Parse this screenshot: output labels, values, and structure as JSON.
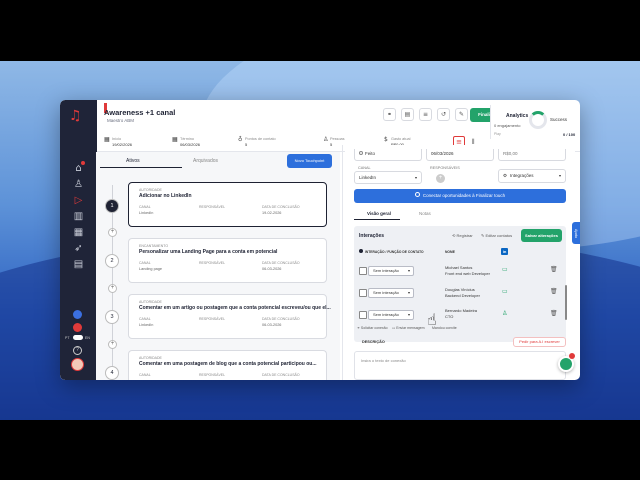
{
  "header": {
    "title": "Awareness +1 canal",
    "subtitle": "Maestro ABM",
    "primary_button": "Finalizar Play",
    "meta": [
      {
        "label": "Início",
        "value": "19/02/2026"
      },
      {
        "label": "Término",
        "value": "06/03/2026"
      },
      {
        "label": "Pontos de contato",
        "value": "5"
      },
      {
        "label": "Pessoas",
        "value": "5"
      },
      {
        "label": "Gasto atual",
        "value": "R$0,00"
      }
    ]
  },
  "analytics": {
    "title": "Analytics",
    "engagement_label": "0 engajamento",
    "status": "Success",
    "score": "0 / 100",
    "sub_label": "Play"
  },
  "left_panel": {
    "tabs": [
      "Ativos",
      "Arquivados"
    ],
    "new_button": "Novo Touchpoint",
    "field_labels": {
      "canal": "CANAL",
      "responsavel": "RESPONSÁVEL",
      "data": "DATA DE CONCLUSÃO"
    },
    "steps": [
      {
        "number": "1",
        "stage": "AUTORIDADE",
        "title": "Adicionar no LinkedIn",
        "canal": "LinkedIn",
        "date": "19-02-2026"
      },
      {
        "number": "2",
        "stage": "ENCANTAMENTO",
        "title": "Personalizar uma Landing Page para a conta em potencial",
        "canal": "Landing page",
        "date": "06-03-2026"
      },
      {
        "number": "3",
        "stage": "AUTORIDADE",
        "title": "Comentar em um artigo ou postagem que a conta potencial escreveu/ou que el...",
        "canal": "LinkedIn",
        "date": "06-03-2026"
      },
      {
        "number": "4",
        "stage": "AUTORIDADE",
        "title": "Comentar em uma postagem de blog que a conta potencial participou ou...",
        "canal": "",
        "date": ""
      }
    ]
  },
  "right_panel": {
    "field_top_left": "Feito",
    "date_value": "06/03/2026",
    "cost_value": "R$0,00",
    "canal_label": "CANAL",
    "canal_value": "LinkedIn",
    "responsaveis_label": "RESPONSÁVEIS",
    "integrations": "Integrações",
    "connect_button": "Conectar oportunidades à Finalizar touch",
    "tabs": [
      "Visão geral",
      "Notas"
    ],
    "interactions": {
      "title": "Interações",
      "actions": [
        "Registrar",
        "Editar contatos"
      ],
      "save_button": "Salvar alterações",
      "col_interaction": "INTERAÇÃO / FUNÇÃO DE CONTATO",
      "col_name": "NOME",
      "rows": [
        {
          "select": "Sem interação",
          "name": "Michael Santos",
          "role": "Front end web Developer"
        },
        {
          "select": "Sem interação",
          "name": "Douglas Vinícius",
          "role": "Backend Developer"
        },
        {
          "select": "Sem interação",
          "name": "Bernardo Madeira",
          "role": "CTO"
        }
      ],
      "legend": [
        "Solicitar conexão",
        "Enviar mensagem",
        "Mandou convite"
      ]
    },
    "description_label": "DESCRIÇÃO",
    "ai_button": "Pedir para A.I escrever",
    "description_placeholder": "Insira o texto de conexão",
    "help_tab": "Ajuda"
  },
  "sidebar": {
    "lang_left": "PT",
    "lang_right": "EN"
  },
  "colors": {
    "accent_green": "#23a36a",
    "accent_blue": "#2d6fdc",
    "brand_red": "#e03a3a",
    "sidebar": "#1f2438"
  }
}
